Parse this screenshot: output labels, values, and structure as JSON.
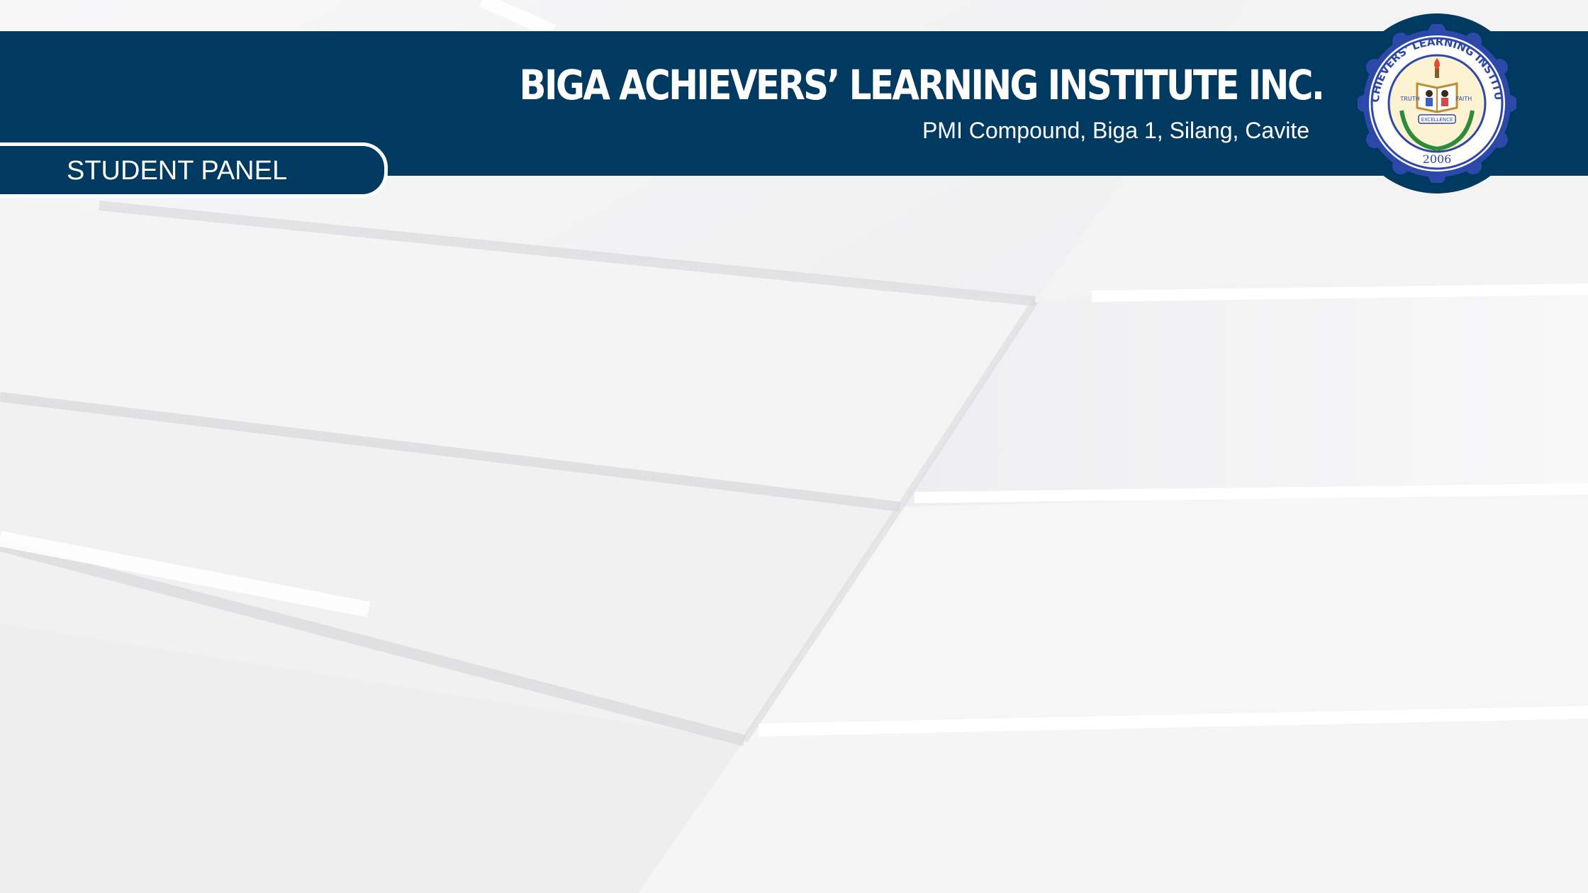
{
  "header": {
    "school_name": "BIGA ACHIEVERS’ LEARNING INSTITUTE INC.",
    "address": "PMI Compound, Biga 1, Silang, Cavite"
  },
  "panel": {
    "label": "STUDENT PANEL"
  },
  "seal": {
    "icon": "school-seal-icon",
    "ring_text": "BIGA ACHIEVERS' LEARNING INSTITUTE INC.",
    "motto": "EXCELLENCE",
    "year": "2006",
    "letters_left": "TRUTH",
    "letters_right": "FAITH"
  },
  "colors": {
    "brand_navy": "#003a61",
    "seal_blue": "#2c48a8",
    "seal_gold": "#f0c43a",
    "background": "#f2f2f3"
  }
}
